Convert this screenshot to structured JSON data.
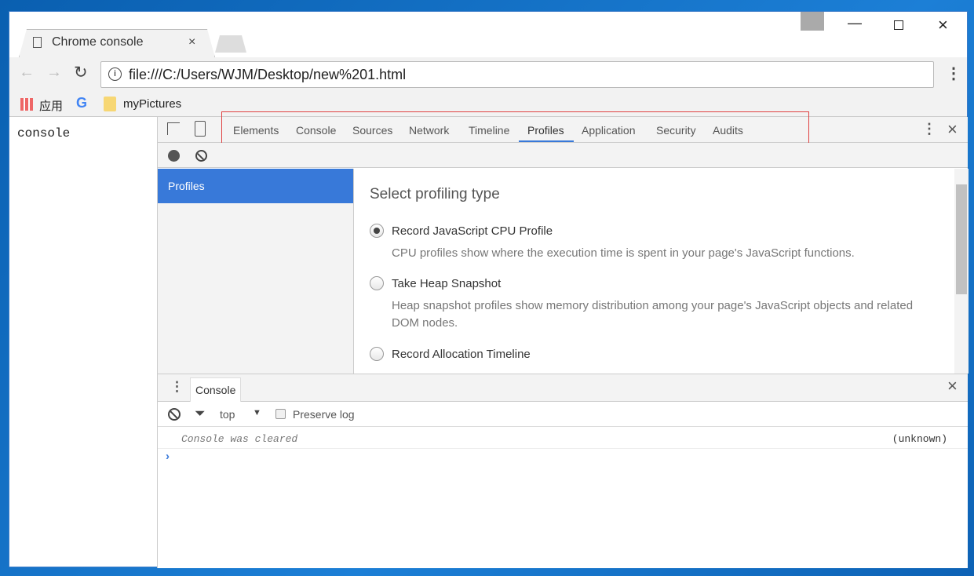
{
  "browser": {
    "tab_title": "Chrome console",
    "url": "file:///C:/Users/WJM/Desktop/new%201.html",
    "bookmarks": [
      {
        "label": "应用"
      },
      {
        "label": "myPictures"
      }
    ]
  },
  "page": {
    "text": "console"
  },
  "devtools": {
    "tabs": [
      "Elements",
      "Console",
      "Sources",
      "Network",
      "Timeline",
      "Profiles",
      "Application",
      "Security",
      "Audits"
    ],
    "selected_tab": "Profiles",
    "sidebar_item": "Profiles",
    "profiles": {
      "heading": "Select profiling type",
      "options": [
        {
          "label": "Record JavaScript CPU Profile",
          "desc": "CPU profiles show where the execution time is spent in your page's JavaScript functions.",
          "checked": true
        },
        {
          "label": "Take Heap Snapshot",
          "desc": "Heap snapshot profiles show memory distribution among your page's JavaScript objects and related DOM nodes.",
          "checked": false
        },
        {
          "label": "Record Allocation Timeline",
          "checked": false
        }
      ]
    },
    "drawer": {
      "tab": "Console",
      "context": "top",
      "preserve_log": "Preserve log",
      "message": "Console was cleared",
      "source": "(unknown)"
    }
  },
  "colors": {
    "accent": "#3879d9",
    "highlight_box": "#e04040"
  }
}
